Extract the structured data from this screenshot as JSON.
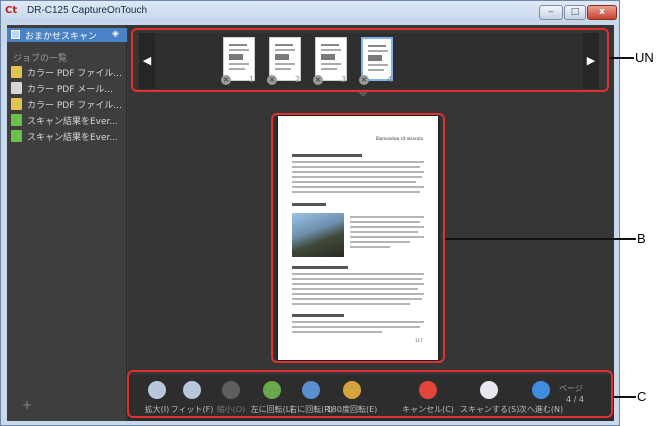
{
  "window": {
    "title": "DR-C125 CaptureOnTouch",
    "app_icon": "Ct",
    "minimize_label": "‒",
    "maximize_label": "□",
    "close_label": "x"
  },
  "sidebar": {
    "header_label": "おまかせスキャン",
    "job_heading": "ジョブの一覧",
    "items": [
      {
        "label": "カラー PDF ファイル...",
        "icon": "document-icon",
        "color": "#e2c24a"
      },
      {
        "label": "カラー PDF メール...",
        "icon": "mail-icon",
        "color": "#d6d6d6"
      },
      {
        "label": "カラー PDF ファイル...",
        "icon": "document-icon",
        "color": "#e2c24a"
      },
      {
        "label": "スキャン結果をEver...",
        "icon": "evernote-icon",
        "color": "#6cbf4a"
      },
      {
        "label": "スキャン結果をEver...",
        "icon": "evernote-icon",
        "color": "#6cbf4a"
      }
    ],
    "add_label": "+"
  },
  "thumbnails": {
    "prev_label": "◀",
    "next_label": "▶",
    "pages": [
      "1",
      "2",
      "3",
      "4"
    ],
    "selected_index": 3
  },
  "preview": {
    "page_heading": "Biomeadow sit alescala",
    "page_number": "117"
  },
  "toolbar": {
    "buttons": [
      {
        "label": "拡大(I)",
        "icon": "zoom-in-icon",
        "color": "#b9c7dc",
        "enabled": true
      },
      {
        "label": "フィット(F)",
        "icon": "fit-icon",
        "color": "#b9c7dc",
        "enabled": true
      },
      {
        "label": "縮小(O)",
        "icon": "zoom-out-icon",
        "color": "#5e5e5e",
        "enabled": false
      },
      {
        "label": "左に回転(L)",
        "icon": "rotate-left-icon",
        "color": "#69a84a",
        "enabled": true
      },
      {
        "label": "右に回転(R)",
        "icon": "rotate-right-icon",
        "color": "#5b8fd0",
        "enabled": true
      },
      {
        "label": "180度回転(E)",
        "icon": "rotate-180-icon",
        "color": "#d6a43c",
        "enabled": true
      },
      {
        "label": "キャンセル(C)",
        "icon": "cancel-icon",
        "color": "#e2453a",
        "enabled": true
      },
      {
        "label": "スキャンする(S)",
        "icon": "scan-icon",
        "color": "#e8e8f0",
        "enabled": true
      },
      {
        "label": "次へ進む(N)",
        "icon": "next-icon",
        "color": "#3f8de0",
        "enabled": true
      }
    ],
    "page_label": "ページ",
    "page_count": "4 / 4"
  },
  "callouts": {
    "un": "UN",
    "b": "B",
    "c": "C"
  }
}
